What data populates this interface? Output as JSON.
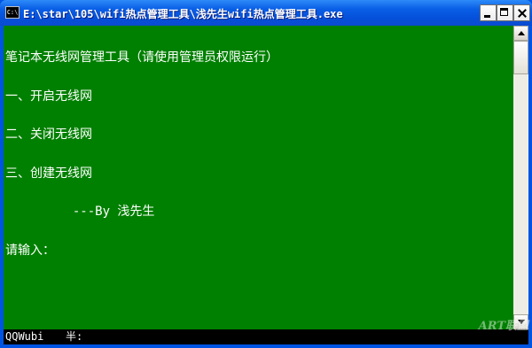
{
  "window": {
    "title": "E:\\star\\105\\wifi热点管理工具\\浅先生wifi热点管理工具.exe",
    "icon_label": "C:\\",
    "controls": [
      "minimize-icon",
      "maximize-icon",
      "close-icon"
    ]
  },
  "console": {
    "lines": [
      "笔记本无线网管理工具（请使用管理员权限运行）",
      "一、开启无线网",
      "二、关闭无线网",
      "三、创建无线网",
      "         ---By 浅先生",
      "请输入："
    ],
    "background_color": "#008000",
    "text_color": "#ffffff"
  },
  "ime": {
    "name": "QQWubi",
    "mode": "半:"
  },
  "watermark": {
    "text": "ART联盟"
  }
}
